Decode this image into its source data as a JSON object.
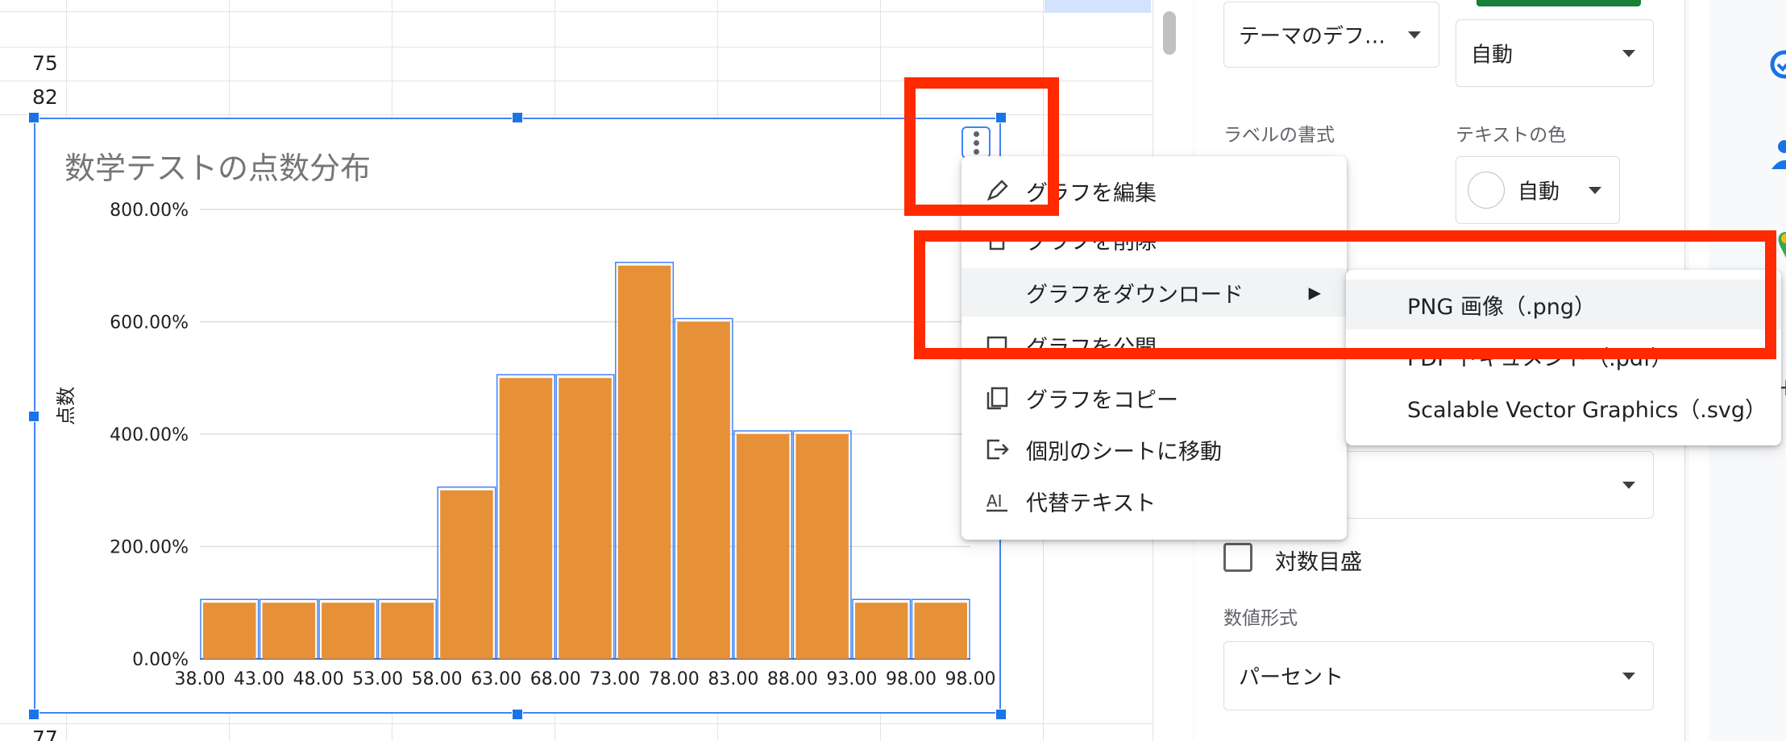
{
  "sheet": {
    "row_numbers_top": [
      "75",
      "82"
    ],
    "row_number_bottom": "77"
  },
  "chart": {
    "title": "数学テストの点数分布",
    "ylabel": "点数"
  },
  "chart_data": {
    "type": "bar",
    "title": "数学テストの点数分布",
    "xlabel": "",
    "ylabel": "点数",
    "ylim": [
      0,
      800
    ],
    "y_ticks": [
      "0.00%",
      "200.00%",
      "400.00%",
      "600.00%",
      "800.00%"
    ],
    "x_ticks": [
      "38.00",
      "43.00",
      "48.00",
      "53.00",
      "58.00",
      "63.00",
      "68.00",
      "73.00",
      "78.00",
      "83.00",
      "88.00",
      "93.00",
      "98.00",
      "98.00"
    ],
    "values": [
      100,
      100,
      100,
      100,
      300,
      500,
      500,
      700,
      600,
      400,
      400,
      100,
      100
    ],
    "bar_color": "#e69138",
    "grid": true
  },
  "menu": {
    "items": [
      {
        "label": "グラフを編集",
        "icon": "pencil-icon"
      },
      {
        "label": "グラフを削除",
        "icon": "trash-icon"
      },
      {
        "label": "グラフをダウンロード",
        "icon": "download-icon"
      },
      {
        "label": "グラフを公開",
        "icon": "publish-icon"
      },
      {
        "label": "グラフをコピー",
        "icon": "copy-icon"
      },
      {
        "label": "個別のシートに移動",
        "icon": "move-to-sheet-icon"
      },
      {
        "label": "代替テキスト",
        "icon": "alt-text-icon"
      }
    ],
    "download_arrow": "▶"
  },
  "submenu": {
    "items": [
      {
        "label": "PNG 画像（.png）"
      },
      {
        "label": "PDF ドキュメント（.pdf）"
      },
      {
        "label": "Scalable Vector Graphics（.svg）"
      }
    ]
  },
  "panel": {
    "theme_font_value": "テーマのデフ…",
    "font_size_value": "自動",
    "label_format_label": "ラベルの書式",
    "text_color_label": "テキストの色",
    "text_color_value": "自動",
    "log_scale_label": "対数目盛",
    "number_format_label": "数値形式",
    "number_format_value": "パーセント"
  },
  "colors": {
    "accent": "#1a73e8",
    "annotation": "#ff2a00",
    "bar": "#e69138"
  }
}
